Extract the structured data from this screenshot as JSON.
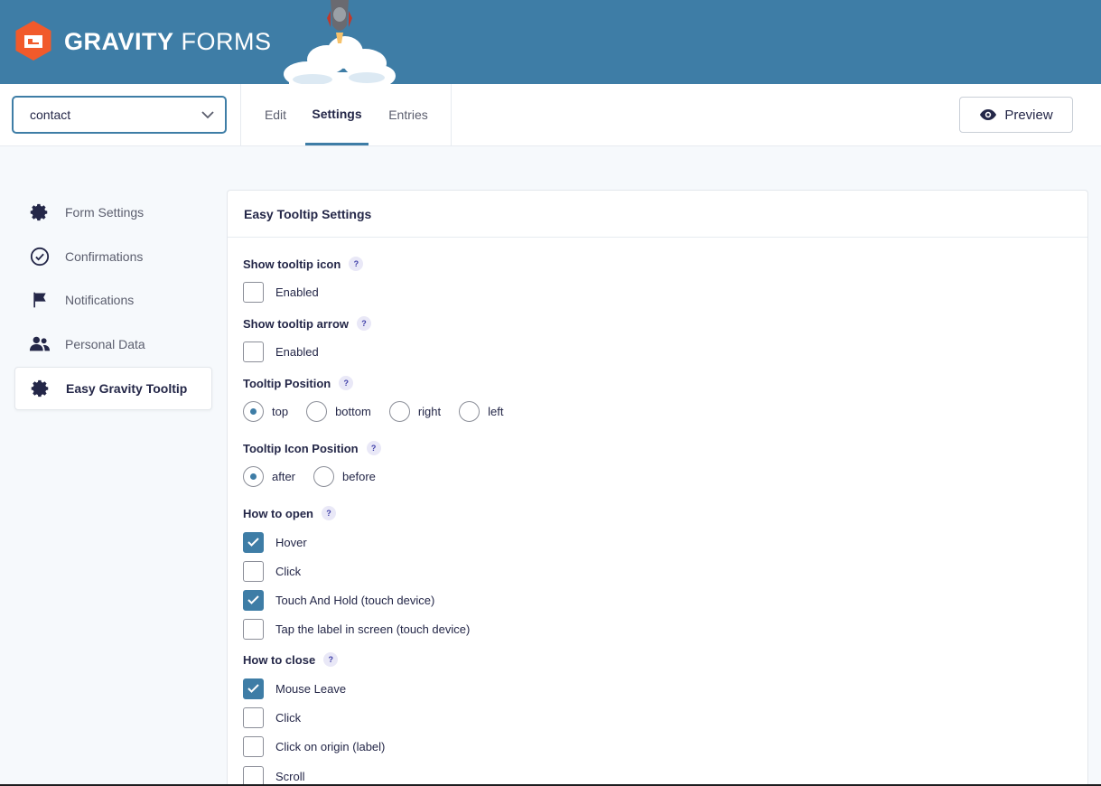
{
  "brand": {
    "name_bold": "GRAVITY",
    "name_light": "FORMS",
    "colors": {
      "header": "#3e7da6",
      "logo": "#f15a2b",
      "accent": "#3e7da6"
    }
  },
  "toolbar": {
    "form_select_value": "contact",
    "tabs": [
      {
        "label": "Edit",
        "active": false
      },
      {
        "label": "Settings",
        "active": true
      },
      {
        "label": "Entries",
        "active": false
      }
    ],
    "preview_label": "Preview"
  },
  "sidebar": {
    "items": [
      {
        "label": "Form Settings",
        "icon": "gear-icon",
        "active": false
      },
      {
        "label": "Confirmations",
        "icon": "check-circle-icon",
        "active": false
      },
      {
        "label": "Notifications",
        "icon": "flag-icon",
        "active": false
      },
      {
        "label": "Personal Data",
        "icon": "people-icon",
        "active": false
      },
      {
        "label": "Easy Gravity Tooltip",
        "icon": "gear-icon",
        "active": true
      }
    ]
  },
  "panel": {
    "title": "Easy Tooltip Settings",
    "help_symbol": "?",
    "show_icon": {
      "label": "Show tooltip icon",
      "option": "Enabled",
      "checked": false
    },
    "show_arrow": {
      "label": "Show tooltip arrow",
      "option": "Enabled",
      "checked": false
    },
    "position": {
      "label": "Tooltip Position",
      "options": [
        "top",
        "bottom",
        "right",
        "left"
      ],
      "selected": "top"
    },
    "icon_position": {
      "label": "Tooltip Icon Position",
      "options": [
        "after",
        "before"
      ],
      "selected": "after"
    },
    "open": {
      "label": "How to open",
      "options": [
        {
          "label": "Hover",
          "checked": true
        },
        {
          "label": "Click",
          "checked": false
        },
        {
          "label": "Touch And Hold (touch device)",
          "checked": true
        },
        {
          "label": "Tap the label in screen (touch device)",
          "checked": false
        }
      ]
    },
    "close": {
      "label": "How to close",
      "options": [
        {
          "label": "Mouse Leave",
          "checked": true
        },
        {
          "label": "Click",
          "checked": false
        },
        {
          "label": "Click on origin (label)",
          "checked": false
        },
        {
          "label": "Scroll",
          "checked": false
        }
      ]
    }
  }
}
